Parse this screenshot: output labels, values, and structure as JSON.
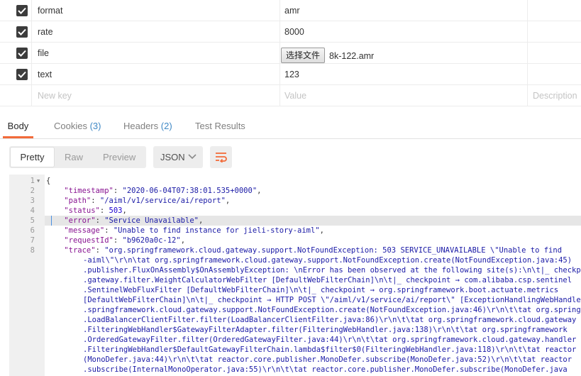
{
  "params": {
    "rows": [
      {
        "key": "format",
        "value": "amr",
        "checked": true
      },
      {
        "key": "rate",
        "value": "8000",
        "checked": true
      },
      {
        "key": "file",
        "button": "选择文件",
        "filename": "8k-122.amr",
        "checked": true
      },
      {
        "key": "text",
        "value": "123",
        "checked": true
      }
    ],
    "new_row": {
      "key_placeholder": "New key",
      "value_placeholder": "Value",
      "description_placeholder": "Description"
    }
  },
  "tabs": [
    {
      "label": "Body"
    },
    {
      "label": "Cookies",
      "count": "(3)"
    },
    {
      "label": "Headers",
      "count": "(2)"
    },
    {
      "label": "Test Results"
    }
  ],
  "toolbar": {
    "modes": [
      "Pretty",
      "Raw",
      "Preview"
    ],
    "format": "JSON"
  },
  "code": {
    "line_numbers": [
      "1",
      "2",
      "3",
      "4",
      "5",
      "6",
      "7",
      "8"
    ],
    "l1": "{",
    "l2k": "\"timestamp\"",
    "l2v": "\"2020-06-04T07:38:01.535+0000\"",
    "l3k": "\"path\"",
    "l3v": "\"/aiml/v1/service/ai/report\"",
    "l4k": "\"status\"",
    "l4v": "503",
    "l5k": "\"error\"",
    "l5v": "\"Service Unavailable\"",
    "l6k": "\"message\"",
    "l6v": "\"Unable to find instance for jieli-story-aiml\"",
    "l7k": "\"requestId\"",
    "l7v": "\"b9620a0c-12\"",
    "l8k": "\"trace\"",
    "l8v": "\"org.springframework.cloud.gateway.support.NotFoundException: 503 SERVICE_UNAVAILABLE \\\"Unable to find",
    "wrap": [
      "-aiml\\\"\\r\\n\\tat org.springframework.cloud.gateway.support.NotFoundException.create(NotFoundException.java:45)",
      ".publisher.FluxOnAssembly$OnAssemblyException: \\nError has been observed at the following site(s):\\n\\t|_ checkpoint",
      ".gateway.filter.WeightCalculatorWebFilter [DefaultWebFilterChain]\\n\\t|_ checkpoint → com.alibaba.csp.sentinel",
      ".SentinelWebFluxFilter [DefaultWebFilterChain]\\n\\t|_ checkpoint → org.springframework.boot.actuate.metrics",
      "[DefaultWebFilterChain]\\n\\t|_ checkpoint → HTTP POST \\\"/aiml/v1/service/ai/report\\\" [ExceptionHandlingWebHandler]",
      ".springframework.cloud.gateway.support.NotFoundException.create(NotFoundException.java:46)\\r\\n\\t\\tat org.springframework",
      ".LoadBalancerClientFilter.filter(LoadBalancerClientFilter.java:86)\\r\\n\\t\\tat org.springframework.cloud.gateway",
      ".FilteringWebHandler$GatewayFilterAdapter.filter(FilteringWebHandler.java:138)\\r\\n\\t\\tat org.springframework",
      ".OrderedGatewayFilter.filter(OrderedGatewayFilter.java:44)\\r\\n\\t\\tat org.springframework.cloud.gateway.handler",
      ".FilteringWebHandler$DefaultGatewayFilterChain.lambda$filter$0(FilteringWebHandler.java:118)\\r\\n\\t\\tat reactor",
      "(MonoDefer.java:44)\\r\\n\\t\\tat reactor.core.publisher.MonoDefer.subscribe(MonoDefer.java:52)\\r\\n\\t\\tat reactor",
      ".subscribe(InternalMonoOperator.java:55)\\r\\n\\t\\tat reactor.core.publisher.MonoDefer.subscribe(MonoDefer.java"
    ]
  }
}
